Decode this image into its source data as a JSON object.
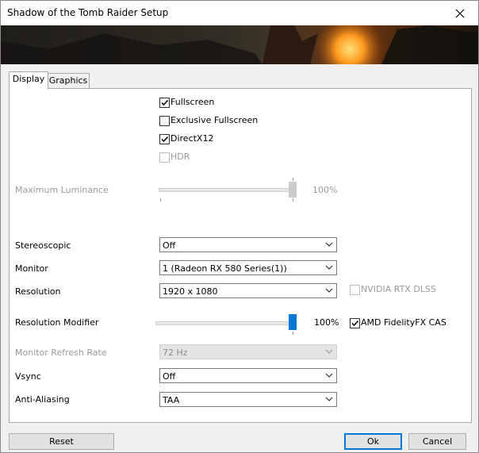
{
  "window": {
    "title": "Shadow of the Tomb Raider Setup"
  },
  "tabs": [
    {
      "label": "Display"
    },
    {
      "label": "Graphics"
    }
  ],
  "display": {
    "checkboxes": {
      "fullscreen": {
        "label": "Fullscreen",
        "checked": true
      },
      "exclusive_fullscreen": {
        "label": "Exclusive Fullscreen",
        "checked": false
      },
      "directx12": {
        "label": "DirectX12",
        "checked": true
      },
      "hdr": {
        "label": "HDR",
        "checked": false,
        "disabled": true
      }
    },
    "max_luminance": {
      "label": "Maximum Luminance",
      "value": "100%",
      "level": 1.0,
      "disabled": true
    },
    "stereoscopic": {
      "label": "Stereoscopic",
      "value": "Off"
    },
    "monitor": {
      "label": "Monitor",
      "value": "1 (Radeon RX 580 Series(1))"
    },
    "resolution": {
      "label": "Resolution",
      "value": "1920 x 1080"
    },
    "nvidia_dlss": {
      "label": "NVIDIA RTX DLSS",
      "checked": false,
      "disabled": true
    },
    "resolution_modifier": {
      "label": "Resolution Modifier",
      "value": "100%",
      "level": 1.0
    },
    "amd_cas": {
      "label": "AMD FidelityFX CAS",
      "checked": true
    },
    "refresh_rate": {
      "label": "Monitor Refresh Rate",
      "value": "72 Hz",
      "disabled": true
    },
    "vsync": {
      "label": "Vsync",
      "value": "Off"
    },
    "anti_aliasing": {
      "label": "Anti-Aliasing",
      "value": "TAA"
    }
  },
  "buttons": {
    "reset": "Reset",
    "ok": "Ok",
    "cancel": "Cancel"
  },
  "colors": {
    "accent": "#0078d7",
    "disabled_text": "#9a9a9a"
  }
}
